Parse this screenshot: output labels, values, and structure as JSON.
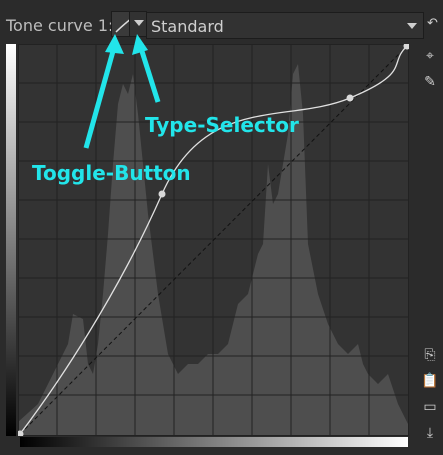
{
  "curve_panel": {
    "label": "Tone curve 1:",
    "selected_type": "Standard"
  },
  "annotations": {
    "toggle_button": "Toggle-Button",
    "type_selector": "Type-Selector",
    "color": "#22e5ea"
  },
  "icons": {
    "reset": "reset-icon",
    "edit_points": "edit-points-icon",
    "pencil": "pencil-icon",
    "copy": "copy-icon",
    "paste": "paste-icon",
    "open": "folder-open-icon",
    "save": "save-icon"
  }
}
